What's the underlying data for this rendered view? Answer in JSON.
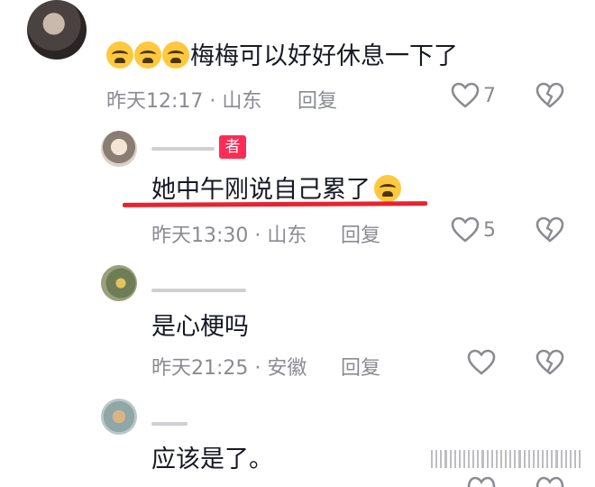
{
  "comments": [
    {
      "text": "梅梅可以好好休息一下了",
      "time": "昨天12:17",
      "location": "山东",
      "reply": "回复",
      "likes": "7"
    },
    {
      "badge": "者",
      "text": "她中午刚说自己累了",
      "time": "昨天13:30",
      "location": "山东",
      "reply": "回复",
      "likes": "5"
    },
    {
      "text": "是心梗吗",
      "time": "昨天21:25",
      "location": "安徽",
      "reply": "回复",
      "likes": ""
    },
    {
      "text": "应该是了。",
      "time": "",
      "location": "",
      "reply": "",
      "likes": ""
    }
  ],
  "meta_separator": "·",
  "icons": {
    "like": "heart-outline-icon",
    "dislike": "broken-heart-icon",
    "emoji_cry": "crying-face-emoji",
    "emoji_tired": "tired-face-emoji"
  },
  "colors": {
    "author_badge": "#fe2c55",
    "underline": "#e8232f",
    "meta_text": "#8a8b91",
    "body_text": "#161823"
  }
}
